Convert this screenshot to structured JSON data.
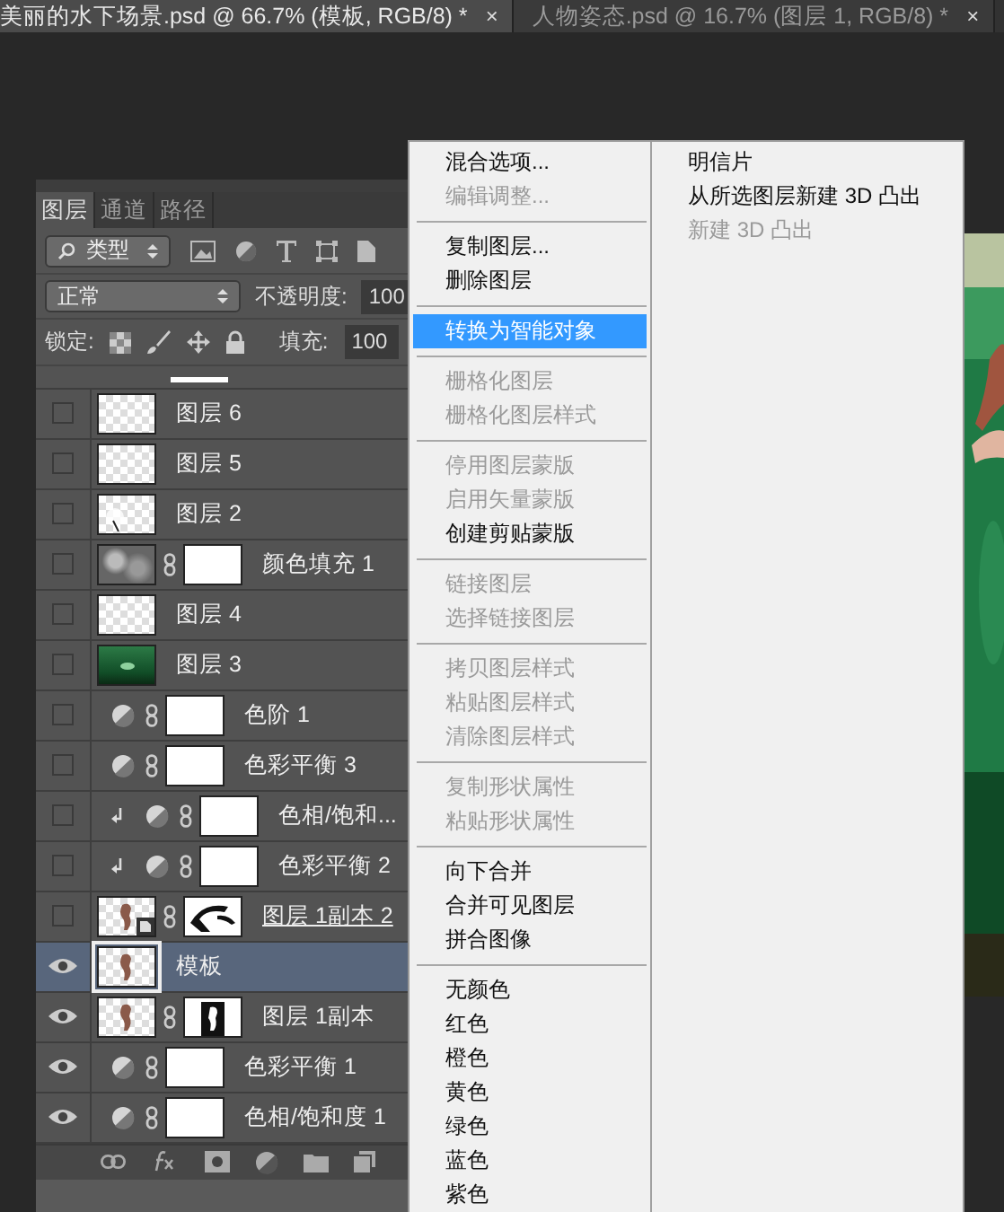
{
  "document_tabs": [
    {
      "title": "美丽的水下场景.psd @ 66.7% (模板, RGB/8) *",
      "close": "×",
      "selected": true
    },
    {
      "title": "人物姿态.psd @ 16.7% (图层 1, RGB/8) *",
      "close": "×",
      "selected": false
    }
  ],
  "layers_panel": {
    "tabs": [
      {
        "label": "图层",
        "selected": true
      },
      {
        "label": "通道",
        "selected": false
      },
      {
        "label": "路径",
        "selected": false
      }
    ],
    "filter": "类型",
    "blend_mode": "正常",
    "opacity_label": "不透明度:",
    "opacity": "100",
    "lock_label": "锁定:",
    "fill_label": "填充:",
    "fill": "100",
    "layers": [
      {
        "name": "图层 6",
        "kind": "pixel",
        "thumb": {
          "kind": "transparent"
        },
        "clipped": false,
        "visible": false,
        "selected": false,
        "underlined": false
      },
      {
        "name": "图层 5",
        "kind": "pixel",
        "thumb": {
          "kind": "transparent"
        },
        "clipped": false,
        "visible": false,
        "selected": false,
        "underlined": false
      },
      {
        "name": "图层 2",
        "kind": "pixel",
        "thumb": {
          "kind": "sketch"
        },
        "clipped": false,
        "visible": false,
        "selected": false,
        "underlined": false
      },
      {
        "name": "颜色填充 1",
        "kind": "fill",
        "thumb": {
          "kind": "noise"
        },
        "mask": {
          "kind": "white"
        },
        "clipped": false,
        "visible": false,
        "selected": false,
        "underlined": false
      },
      {
        "name": "图层 4",
        "kind": "pixel",
        "thumb": {
          "kind": "transparent"
        },
        "clipped": false,
        "visible": false,
        "selected": false,
        "underlined": false
      },
      {
        "name": "图层 3",
        "kind": "pixel",
        "thumb": {
          "kind": "green"
        },
        "clipped": false,
        "visible": false,
        "selected": false,
        "underlined": false
      },
      {
        "name": "色阶 1",
        "kind": "adjustment",
        "mask": {
          "kind": "white"
        },
        "clipped": false,
        "visible": false,
        "selected": false,
        "underlined": false
      },
      {
        "name": "色彩平衡 3",
        "kind": "adjustment",
        "mask": {
          "kind": "white"
        },
        "clipped": false,
        "visible": false,
        "selected": false,
        "underlined": false
      },
      {
        "name": "色相/饱和...",
        "kind": "adjustment",
        "mask": {
          "kind": "white"
        },
        "clipped": true,
        "visible": false,
        "selected": false,
        "underlined": false
      },
      {
        "name": "色彩平衡 2",
        "kind": "adjustment",
        "mask": {
          "kind": "white"
        },
        "clipped": true,
        "visible": false,
        "selected": false,
        "underlined": false
      },
      {
        "name": "图层 1副本 2",
        "kind": "smart",
        "thumb": {
          "kind": "figure"
        },
        "mask": {
          "kind": "shape"
        },
        "clipped": false,
        "visible": false,
        "selected": false,
        "underlined": true
      },
      {
        "name": "模板",
        "kind": "pixel",
        "thumb": {
          "kind": "figure"
        },
        "clipped": false,
        "visible": true,
        "selected": true,
        "underlined": false
      },
      {
        "name": "图层 1副本",
        "kind": "pixel",
        "thumb": {
          "kind": "figure"
        },
        "mask": {
          "kind": "figure"
        },
        "clipped": false,
        "visible": true,
        "selected": false,
        "underlined": false
      },
      {
        "name": "色彩平衡 1",
        "kind": "adjustment",
        "mask": {
          "kind": "white"
        },
        "clipped": false,
        "visible": true,
        "selected": false,
        "underlined": false
      },
      {
        "name": "色相/饱和度 1",
        "kind": "adjustment",
        "mask": {
          "kind": "white"
        },
        "clipped": false,
        "visible": true,
        "selected": false,
        "underlined": false
      }
    ]
  },
  "context_menu": {
    "groups": [
      [
        {
          "label": "混合选项...",
          "disabled": false,
          "highlighted": false
        },
        {
          "label": "编辑调整...",
          "disabled": true,
          "highlighted": false
        }
      ],
      [
        {
          "label": "复制图层...",
          "disabled": false,
          "highlighted": false
        },
        {
          "label": "删除图层",
          "disabled": false,
          "highlighted": false
        }
      ],
      [
        {
          "label": "转换为智能对象",
          "disabled": false,
          "highlighted": true
        }
      ],
      [
        {
          "label": "栅格化图层",
          "disabled": true,
          "highlighted": false
        },
        {
          "label": "栅格化图层样式",
          "disabled": true,
          "highlighted": false
        }
      ],
      [
        {
          "label": "停用图层蒙版",
          "disabled": true,
          "highlighted": false
        },
        {
          "label": "启用矢量蒙版",
          "disabled": true,
          "highlighted": false
        },
        {
          "label": "创建剪贴蒙版",
          "disabled": false,
          "highlighted": false
        }
      ],
      [
        {
          "label": "链接图层",
          "disabled": true,
          "highlighted": false
        },
        {
          "label": "选择链接图层",
          "disabled": true,
          "highlighted": false
        }
      ],
      [
        {
          "label": "拷贝图层样式",
          "disabled": true,
          "highlighted": false
        },
        {
          "label": "粘贴图层样式",
          "disabled": true,
          "highlighted": false
        },
        {
          "label": "清除图层样式",
          "disabled": true,
          "highlighted": false
        }
      ],
      [
        {
          "label": "复制形状属性",
          "disabled": true,
          "highlighted": false
        },
        {
          "label": "粘贴形状属性",
          "disabled": true,
          "highlighted": false
        }
      ],
      [
        {
          "label": "向下合并",
          "disabled": false,
          "highlighted": false
        },
        {
          "label": "合并可见图层",
          "disabled": false,
          "highlighted": false
        },
        {
          "label": "拼合图像",
          "disabled": false,
          "highlighted": false
        }
      ],
      [
        {
          "label": "无颜色",
          "disabled": false,
          "highlighted": false
        },
        {
          "label": "红色",
          "disabled": false,
          "highlighted": false
        },
        {
          "label": "橙色",
          "disabled": false,
          "highlighted": false
        },
        {
          "label": "黄色",
          "disabled": false,
          "highlighted": false
        },
        {
          "label": "绿色",
          "disabled": false,
          "highlighted": false
        },
        {
          "label": "蓝色",
          "disabled": false,
          "highlighted": false
        },
        {
          "label": "紫色",
          "disabled": false,
          "highlighted": false
        }
      ]
    ],
    "right_items": [
      {
        "label": "明信片",
        "disabled": false
      },
      {
        "label": "从所选图层新建 3D 凸出",
        "disabled": false
      },
      {
        "label": "新建 3D 凸出",
        "disabled": true
      }
    ]
  }
}
